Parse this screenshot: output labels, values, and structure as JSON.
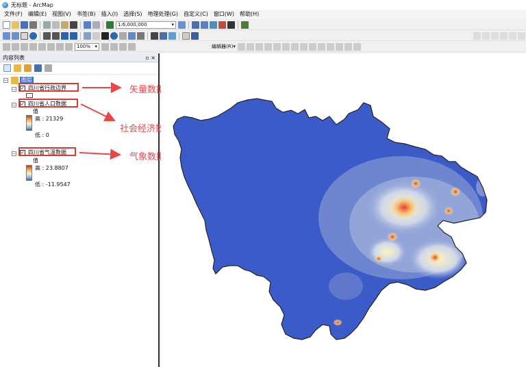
{
  "window": {
    "title": "无标题 - ArcMap"
  },
  "menu": [
    "文件(F)",
    "编辑(E)",
    "视图(V)",
    "书签(B)",
    "插入(I)",
    "选择(S)",
    "地理处理(G)",
    "自定义(C)",
    "窗口(W)",
    "帮助(H)"
  ],
  "toolbar": {
    "scale": "1:6,000,000",
    "zoom": "100%",
    "editor_label": "编辑器(R)▾"
  },
  "toc": {
    "title": "内容列表",
    "controls": "▫ ×",
    "group": "图层",
    "layers": [
      {
        "name": "四川省行政边界",
        "checked": true,
        "annotation": "矢量数据"
      },
      {
        "name": "四川省人口数据",
        "checked": true,
        "value_label": "值",
        "high": "高 : 21329",
        "low": "低 : 0",
        "annotation": "社会经济数据"
      },
      {
        "name": "四川省气温数据",
        "checked": true,
        "value_label": "值",
        "high": "高 : 23.8807",
        "low": "低 : -11.9547",
        "annotation": "气象数据"
      }
    ]
  },
  "colors": {
    "annotation": "#e8474a",
    "ramp_high": "#d7301f",
    "ramp_mid": "#fff5c0",
    "ramp_low": "#3a5fcd",
    "map_base": "#3b5bc9"
  }
}
